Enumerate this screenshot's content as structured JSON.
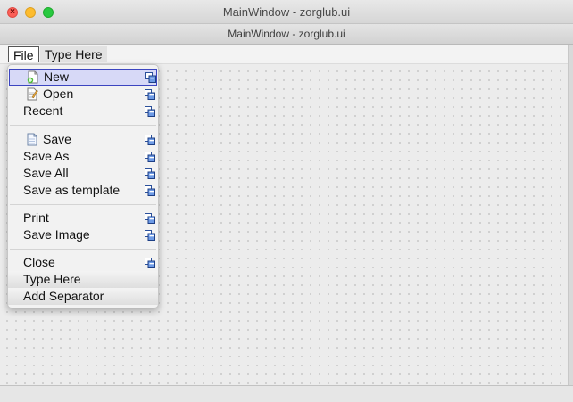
{
  "window": {
    "title": "MainWindow - zorglub.ui",
    "subtitle": "MainWindow - zorglub.ui",
    "close_glyph": "×"
  },
  "menubar": {
    "menus": [
      {
        "label": "File"
      },
      {
        "label": "Type Here"
      }
    ]
  },
  "file_menu": {
    "items": [
      {
        "label": "New",
        "icon": "new-file-icon",
        "submenu_icon": "action-editor-icon",
        "selected": true
      },
      {
        "label": "Open",
        "icon": "open-file-icon",
        "submenu_icon": "action-editor-icon"
      },
      {
        "label": "Recent",
        "submenu_icon": "action-editor-icon"
      },
      {
        "label": "Save",
        "icon": "save-file-icon",
        "submenu_icon": "action-editor-icon"
      },
      {
        "label": "Save As",
        "submenu_icon": "action-editor-icon"
      },
      {
        "label": "Save All",
        "submenu_icon": "action-editor-icon"
      },
      {
        "label": "Save as template",
        "submenu_icon": "action-editor-icon"
      },
      {
        "label": "Print",
        "submenu_icon": "action-editor-icon"
      },
      {
        "label": "Save Image",
        "submenu_icon": "action-editor-icon"
      },
      {
        "label": "Close",
        "submenu_icon": "action-editor-icon"
      },
      {
        "label": "Type Here"
      },
      {
        "label": "Add Separator"
      }
    ]
  },
  "colors": {
    "selection_bg": "#d7d9f7",
    "selection_border": "#3c45c0",
    "traffic_close": "#fc5f57",
    "traffic_min": "#fdbc2e",
    "traffic_max": "#29c940"
  }
}
